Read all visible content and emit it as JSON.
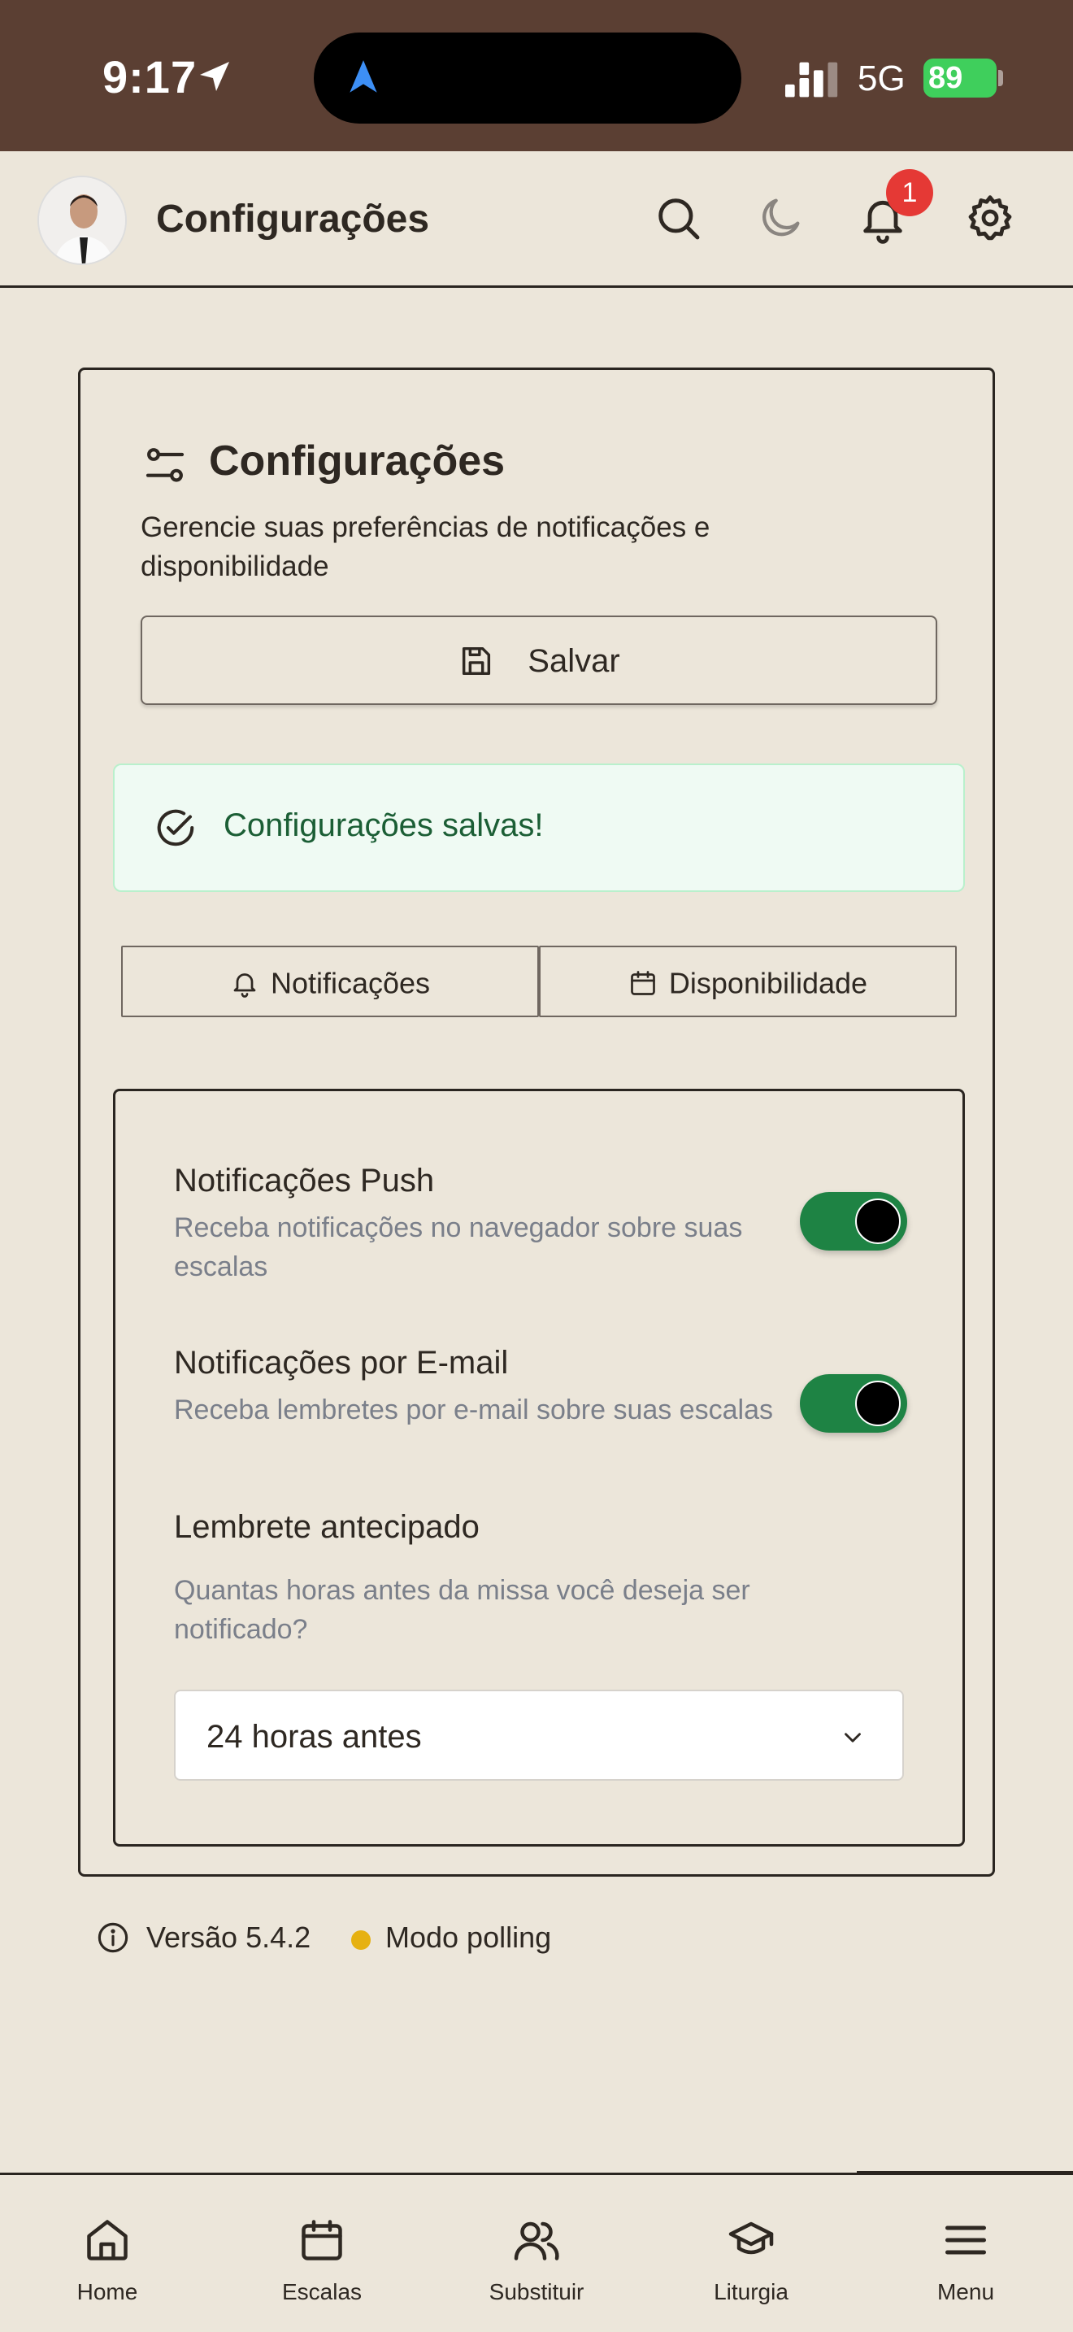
{
  "status_bar": {
    "time": "9:17",
    "network": "5G",
    "battery": "89"
  },
  "header": {
    "title": "Configurações",
    "notification_count": "1",
    "icons": [
      "search-icon",
      "moon-icon",
      "bell-icon",
      "gear-icon"
    ]
  },
  "card": {
    "title": "Configurações",
    "description": "Gerencie suas preferências de notificações e disponibilidade",
    "save_label": "Salvar",
    "alert_text": "Configurações salvas!",
    "tabs": [
      {
        "label": "Notificações",
        "icon": "bell-icon"
      },
      {
        "label": "Disponibilidade",
        "icon": "calendar-icon"
      }
    ],
    "settings": {
      "push": {
        "title": "Notificações Push",
        "description": "Receba notificações no navegador sobre suas escalas",
        "enabled": true
      },
      "email": {
        "title": "Notificações por E-mail",
        "description": "Receba lembretes por e-mail sobre suas escalas",
        "enabled": true
      },
      "reminder": {
        "title": "Lembrete antecipado",
        "description": "Quantas horas antes da missa você deseja ser notificado?",
        "selected": "24 horas antes"
      }
    }
  },
  "footer": {
    "version": "Versão 5.4.2",
    "mode": "Modo polling",
    "mode_color": "#e6b111"
  },
  "bottom_nav": [
    {
      "label": "Home",
      "icon": "home-icon"
    },
    {
      "label": "Escalas",
      "icon": "calendar-icon"
    },
    {
      "label": "Substituir",
      "icon": "users-icon"
    },
    {
      "label": "Liturgia",
      "icon": "graduation-cap-icon"
    },
    {
      "label": "Menu",
      "icon": "menu-icon"
    }
  ],
  "colors": {
    "status_bar": "#5b3f33",
    "background": "#ece6da",
    "toggle_on": "#1e8344",
    "alert_bg": "#effaf3",
    "alert_text": "#1b5e35",
    "badge": "#e53935"
  }
}
